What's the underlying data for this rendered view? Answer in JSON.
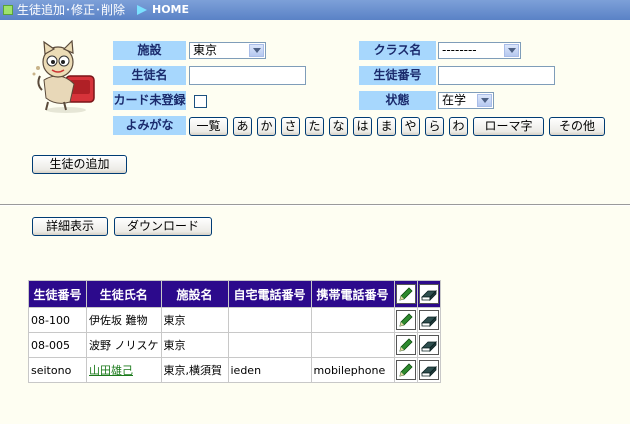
{
  "header": {
    "title": "生徒追加･修正･削除",
    "home": "HOME",
    "colors": {
      "bar": "#6a8fd0",
      "square": "#9ee26d",
      "arrow": "#7be0ff"
    }
  },
  "mascot": {
    "icon": "cat-mascot-icon"
  },
  "search": {
    "facility_label": "施設",
    "facility_value": "東京",
    "class_label": "クラス名",
    "class_value": "--------",
    "student_name_label": "生徒名",
    "student_name_value": "",
    "student_number_label": "生徒番号",
    "student_number_value": "",
    "card_label": "カード未登録",
    "card_checked": false,
    "status_label": "状態",
    "status_value": "在学",
    "yomigana_label": "よみがな",
    "kana_buttons": [
      "一覧",
      "あ",
      "か",
      "さ",
      "た",
      "な",
      "は",
      "ま",
      "や",
      "ら",
      "わ",
      "ローマ字",
      "その他"
    ]
  },
  "actions": {
    "add_student": "生徒の追加",
    "detail_view": "詳細表示",
    "download": "ダウンロード"
  },
  "table": {
    "columns": [
      "生徒番号",
      "生徒氏名",
      "施設名",
      "自宅電話番号",
      "携帯電話番号"
    ],
    "icons": [
      "pencil-icon",
      "eraser-icon"
    ],
    "rows": [
      {
        "number": "08-100",
        "name": "伊佐坂 難物",
        "facility": "東京",
        "home_phone": "",
        "mobile_phone": ""
      },
      {
        "number": "08-005",
        "name": "波野 ノリスケ",
        "facility": "東京",
        "home_phone": "",
        "mobile_phone": ""
      },
      {
        "number": "seitono",
        "name": "山田雄己",
        "facility": "東京,横須賀",
        "home_phone": "ieden",
        "mobile_phone": "mobilephone"
      }
    ],
    "colors": {
      "header_bg": "#2c0a8c",
      "link": "#1b7a1b"
    }
  }
}
